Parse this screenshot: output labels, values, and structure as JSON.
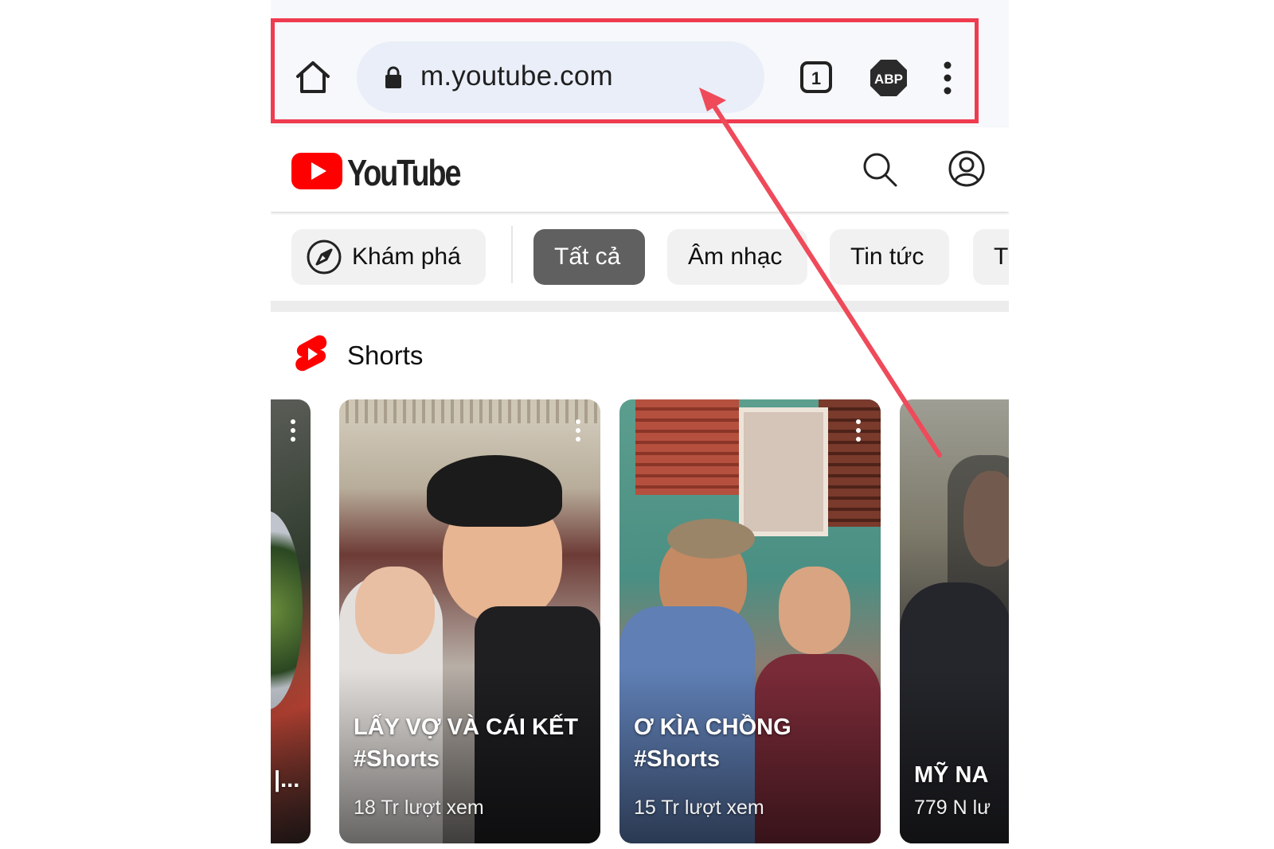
{
  "browser": {
    "url": "m.youtube.com",
    "tab_count": "1",
    "adblock_label": "ABP"
  },
  "youtube": {
    "logo_text": "YouTube"
  },
  "chips": [
    {
      "label": "Khám phá"
    },
    {
      "label": "Tất cả"
    },
    {
      "label": "Âm nhạc"
    },
    {
      "label": "Tin tức"
    },
    {
      "label": "T"
    }
  ],
  "shorts": {
    "section_title": "Shorts",
    "items": [
      {
        "title": "|...",
        "views": ""
      },
      {
        "title_line1": "LẤY VỢ VÀ CÁI KẾT",
        "title_line2": "#Shorts",
        "views": "18 Tr lượt xem"
      },
      {
        "title_line1": "Ơ KÌA CHỒNG",
        "title_line2": "#Shorts",
        "views": "15 Tr lượt xem"
      },
      {
        "title_line1": "MỸ NA",
        "views": "779 N lư"
      }
    ]
  },
  "annotation": {
    "highlight_color": "#ef3b4f",
    "arrow_color": "#ef4a5a"
  }
}
